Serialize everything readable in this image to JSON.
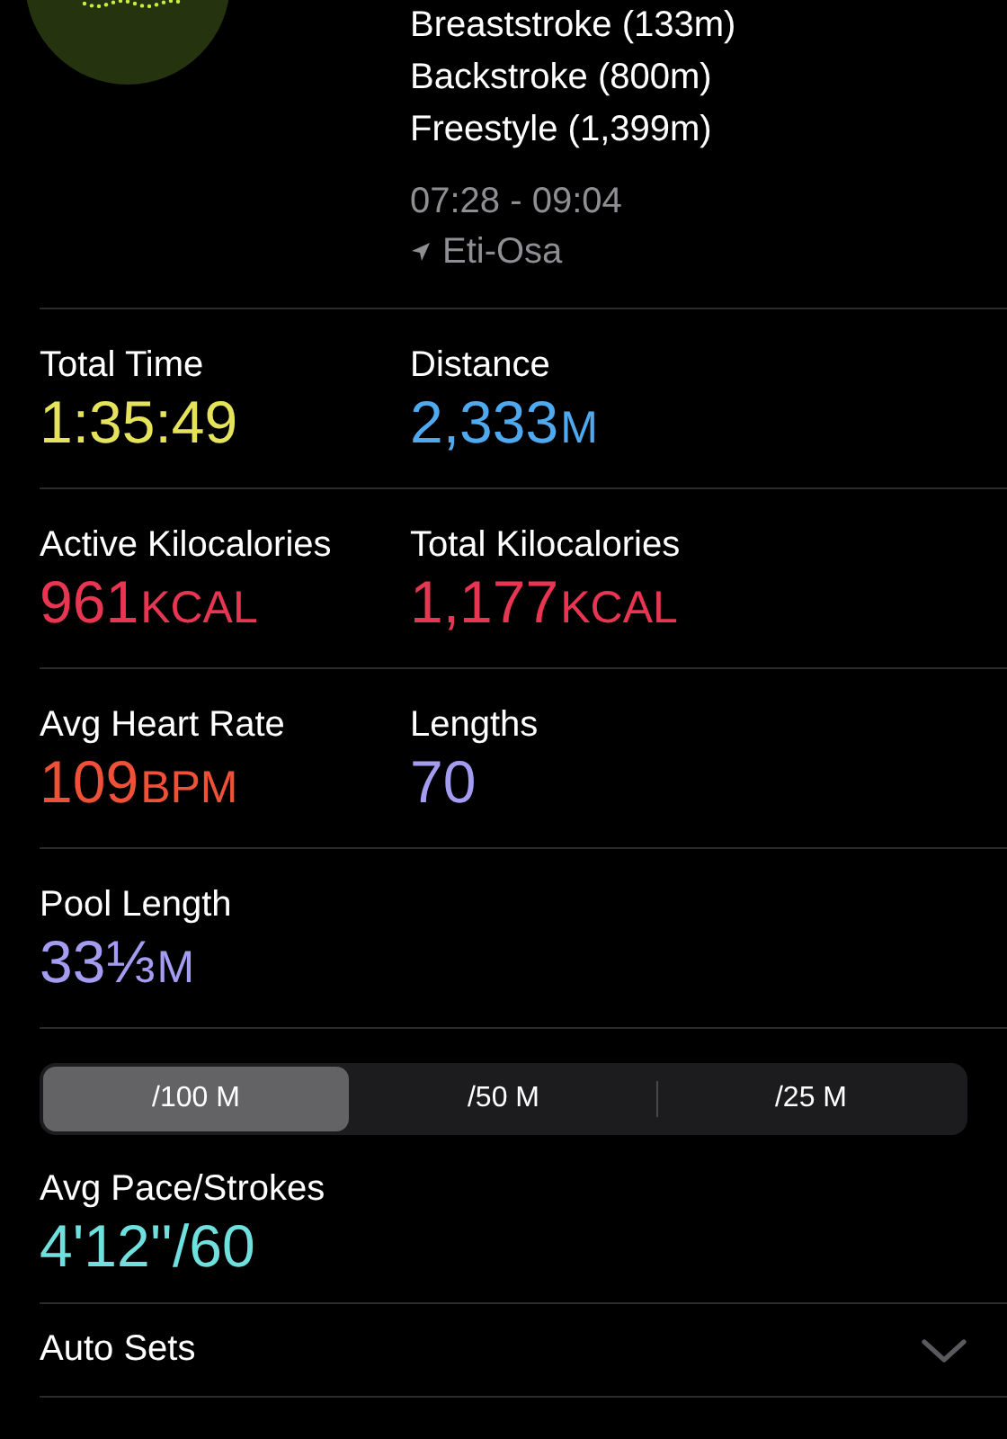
{
  "strokes": [
    "Breaststroke (133m)",
    "Backstroke (800m)",
    "Freestyle (1,399m)"
  ],
  "time_range": "07:28 - 09:04",
  "location": "Eti-Osa",
  "metric_rows": [
    [
      {
        "label": "Total Time",
        "value": "1:35:49",
        "color": "#e5e35b"
      },
      {
        "label": "Distance",
        "value": "2,333",
        "unit": "M",
        "color": "#4fa9ef"
      }
    ],
    [
      {
        "label": "Active Kilocalories",
        "value": "961",
        "unit": "KCAL",
        "color": "#e83552"
      },
      {
        "label": "Total Kilocalories",
        "value": "1,177",
        "unit": "KCAL",
        "color": "#e83552"
      }
    ],
    [
      {
        "label": "Avg Heart Rate",
        "value": "109",
        "unit": "BPM",
        "color": "#ee5138"
      },
      {
        "label": "Lengths",
        "value": "70",
        "color": "#a49cf0"
      }
    ],
    [
      {
        "label": "Pool Length",
        "value": "33⅓",
        "unit": "M",
        "color": "#a49cf0"
      }
    ]
  ],
  "pace_tabs": [
    {
      "label": "/100 M",
      "selected": true
    },
    {
      "label": "/50 M",
      "selected": false
    },
    {
      "label": "/25 M",
      "selected": false
    }
  ],
  "pace": {
    "label": "Avg Pace/Strokes",
    "value": "4'12''/60",
    "color": "#6fe0dd"
  },
  "auto_sets": {
    "label": "Auto Sets",
    "expanded": false
  }
}
